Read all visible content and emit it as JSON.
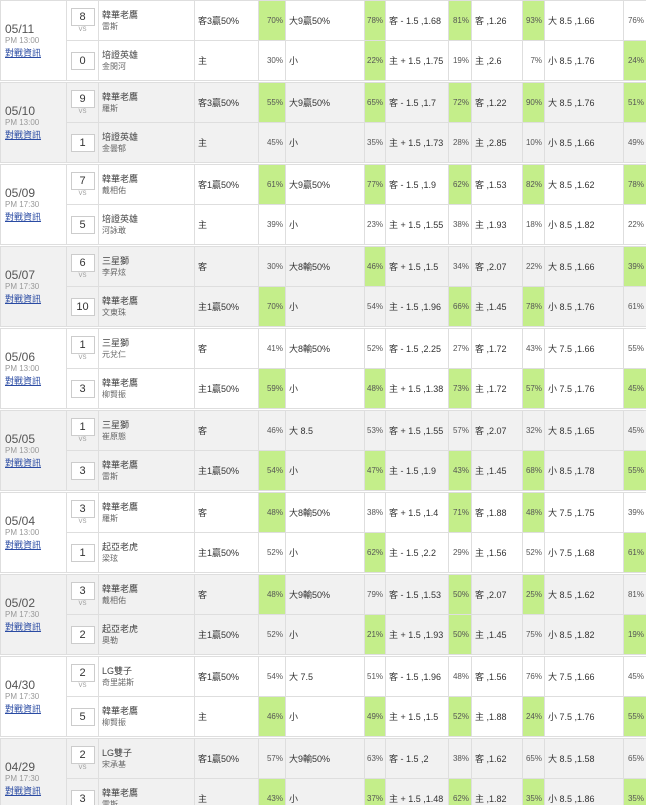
{
  "games": [
    {
      "date": "05/11",
      "time": "PM 13:00",
      "link": "對戰資訊",
      "away": {
        "score": "8",
        "team": "韓華老鷹",
        "pitcher": "雷斯"
      },
      "home": {
        "score": "0",
        "team": "培證英雄",
        "pitcher": "金閔河"
      },
      "away_line": {
        "h": "客3贏50%",
        "hp": "70%",
        "ou": "大9贏50%",
        "oup": "78%",
        "rl": "客 - 1.5 ,1.68",
        "rlp": "81%",
        "ml": "客 ,1.26",
        "mlp": "93%",
        "t": "大 8.5 ,1.66",
        "tp": "76%"
      },
      "home_line": {
        "h": "主",
        "hp": "30%",
        "ou": "小",
        "oup": "22%",
        "rl": "主 + 1.5 ,1.75",
        "rlp": "19%",
        "ml": "主 ,2.6",
        "mlp": "7%",
        "t": "小 8.5 ,1.76",
        "tp": "24%"
      },
      "hi_away": [
        "hp",
        "oup",
        "rlp",
        "mlp"
      ],
      "hi_home": [
        "oup",
        "tp"
      ]
    },
    {
      "date": "05/10",
      "time": "PM 13:00",
      "link": "對戰資訊",
      "away": {
        "score": "9",
        "team": "韓華老鷹",
        "pitcher": "羅斯"
      },
      "home": {
        "score": "1",
        "team": "培證英雄",
        "pitcher": "金曇郁"
      },
      "away_line": {
        "h": "客3贏50%",
        "hp": "55%",
        "ou": "大9贏50%",
        "oup": "65%",
        "rl": "客 - 1.5 ,1.7",
        "rlp": "72%",
        "ml": "客 ,1.22",
        "mlp": "90%",
        "t": "大 8.5 ,1.76",
        "tp": "51%"
      },
      "home_line": {
        "h": "主",
        "hp": "45%",
        "ou": "小",
        "oup": "35%",
        "rl": "主 + 1.5 ,1.73",
        "rlp": "28%",
        "ml": "主 ,2.85",
        "mlp": "10%",
        "t": "小 8.5 ,1.66",
        "tp": "49%"
      },
      "hi_away": [
        "hp",
        "oup",
        "rlp",
        "mlp",
        "tp"
      ],
      "hi_home": []
    },
    {
      "date": "05/09",
      "time": "PM 17:30",
      "link": "對戰資訊",
      "away": {
        "score": "7",
        "team": "韓華老鷹",
        "pitcher": "戴相佑"
      },
      "home": {
        "score": "5",
        "team": "培證英雄",
        "pitcher": "河詠敢"
      },
      "away_line": {
        "h": "客1贏50%",
        "hp": "61%",
        "ou": "大9贏50%",
        "oup": "77%",
        "rl": "客 - 1.5 ,1.9",
        "rlp": "62%",
        "ml": "客 ,1.53",
        "mlp": "82%",
        "t": "大 8.5 ,1.62",
        "tp": "78%"
      },
      "home_line": {
        "h": "主",
        "hp": "39%",
        "ou": "小",
        "oup": "23%",
        "rl": "主 + 1.5 ,1.55",
        "rlp": "38%",
        "ml": "主 ,1.93",
        "mlp": "18%",
        "t": "小 8.5 ,1.82",
        "tp": "22%"
      },
      "hi_away": [
        "hp",
        "oup",
        "rlp",
        "mlp",
        "tp"
      ],
      "hi_home": []
    },
    {
      "date": "05/07",
      "time": "PM 17:30",
      "link": "對戰資訊",
      "away": {
        "score": "6",
        "team": "三星獅",
        "pitcher": "李昇炫"
      },
      "home": {
        "score": "10",
        "team": "韓華老鷹",
        "pitcher": "文東珠"
      },
      "away_line": {
        "h": "客",
        "hp": "30%",
        "ou": "大8輸50%",
        "oup": "46%",
        "rl": "客 + 1.5 ,1.5",
        "rlp": "34%",
        "ml": "客 ,2.07",
        "mlp": "22%",
        "t": "大 8.5 ,1.66",
        "tp": "39%"
      },
      "home_line": {
        "h": "主1贏50%",
        "hp": "70%",
        "ou": "小",
        "oup": "54%",
        "rl": "主 - 1.5 ,1.96",
        "rlp": "66%",
        "ml": "主 ,1.45",
        "mlp": "78%",
        "t": "小 8.5 ,1.76",
        "tp": "61%"
      },
      "hi_away": [
        "oup",
        "tp"
      ],
      "hi_home": [
        "hp",
        "rlp",
        "mlp"
      ]
    },
    {
      "date": "05/06",
      "time": "PM 13:00",
      "link": "對戰資訊",
      "away": {
        "score": "1",
        "team": "三星獅",
        "pitcher": "元兌仁"
      },
      "home": {
        "score": "3",
        "team": "韓華老鷹",
        "pitcher": "柳賢振"
      },
      "away_line": {
        "h": "客",
        "hp": "41%",
        "ou": "大8輸50%",
        "oup": "52%",
        "rl": "客 - 1.5 ,2.25",
        "rlp": "27%",
        "ml": "客 ,1.72",
        "mlp": "43%",
        "t": "大 7.5 ,1.66",
        "tp": "55%"
      },
      "home_line": {
        "h": "主1贏50%",
        "hp": "59%",
        "ou": "小",
        "oup": "48%",
        "rl": "主 + 1.5 ,1.38",
        "rlp": "73%",
        "ml": "主 ,1.72",
        "mlp": "57%",
        "t": "小 7.5 ,1.76",
        "tp": "45%"
      },
      "hi_away": [],
      "hi_home": [
        "hp",
        "oup",
        "rlp",
        "mlp",
        "tp"
      ]
    },
    {
      "date": "05/05",
      "time": "PM 13:00",
      "link": "對戰資訊",
      "away": {
        "score": "1",
        "team": "三星獅",
        "pitcher": "崔原態"
      },
      "home": {
        "score": "3",
        "team": "韓華老鷹",
        "pitcher": "雷斯"
      },
      "away_line": {
        "h": "客",
        "hp": "46%",
        "ou": "大 8.5",
        "oup": "53%",
        "rl": "客 + 1.5 ,1.55",
        "rlp": "57%",
        "ml": "客 ,2.07",
        "mlp": "32%",
        "t": "大 8.5 ,1.65",
        "tp": "45%"
      },
      "home_line": {
        "h": "主1贏50%",
        "hp": "54%",
        "ou": "小",
        "oup": "47%",
        "rl": "主 - 1.5 ,1.9",
        "rlp": "43%",
        "ml": "主 ,1.45",
        "mlp": "68%",
        "t": "小 8.5 ,1.78",
        "tp": "55%"
      },
      "hi_away": [],
      "hi_home": [
        "hp",
        "oup",
        "rlp",
        "mlp",
        "tp"
      ]
    },
    {
      "date": "05/04",
      "time": "PM 13:00",
      "link": "對戰資訊",
      "away": {
        "score": "3",
        "team": "韓華老鷹",
        "pitcher": "羅斯"
      },
      "home": {
        "score": "1",
        "team": "起亞老虎",
        "pitcher": "梁玹"
      },
      "away_line": {
        "h": "客",
        "hp": "48%",
        "ou": "大8輸50%",
        "oup": "38%",
        "rl": "客 + 1.5 ,1.4",
        "rlp": "71%",
        "ml": "客 ,1.88",
        "mlp": "48%",
        "t": "大 7.5 ,1.75",
        "tp": "39%"
      },
      "home_line": {
        "h": "主1贏50%",
        "hp": "52%",
        "ou": "小",
        "oup": "62%",
        "rl": "主 - 1.5 ,2.2",
        "rlp": "29%",
        "ml": "主 ,1.56",
        "mlp": "52%",
        "t": "小 7.5 ,1.68",
        "tp": "61%"
      },
      "hi_away": [
        "hp",
        "rlp",
        "mlp"
      ],
      "hi_home": [
        "oup",
        "tp"
      ]
    },
    {
      "date": "05/02",
      "time": "PM 17:30",
      "link": "對戰資訊",
      "away": {
        "score": "3",
        "team": "韓華老鷹",
        "pitcher": "戴相佑"
      },
      "home": {
        "score": "2",
        "team": "起亞老虎",
        "pitcher": "奧勒"
      },
      "away_line": {
        "h": "客",
        "hp": "48%",
        "ou": "大9輸50%",
        "oup": "79%",
        "rl": "客 - 1.5 ,1.53",
        "rlp": "50%",
        "ml": "客 ,2.07",
        "mlp": "25%",
        "t": "大 8.5 ,1.62",
        "tp": "81%"
      },
      "home_line": {
        "h": "主1贏50%",
        "hp": "52%",
        "ou": "小",
        "oup": "21%",
        "rl": "主 + 1.5 ,1.93",
        "rlp": "50%",
        "ml": "主 ,1.45",
        "mlp": "75%",
        "t": "小 8.5 ,1.82",
        "tp": "19%"
      },
      "hi_away": [
        "hp",
        "rlp",
        "mlp"
      ],
      "hi_home": [
        "oup",
        "rlp",
        "tp"
      ]
    },
    {
      "date": "04/30",
      "time": "PM 17:30",
      "link": "對戰資訊",
      "away": {
        "score": "2",
        "team": "LG雙子",
        "pitcher": "奇里諾斯"
      },
      "home": {
        "score": "5",
        "team": "韓華老鷹",
        "pitcher": "柳賢振"
      },
      "away_line": {
        "h": "客1贏50%",
        "hp": "54%",
        "ou": "大 7.5",
        "oup": "51%",
        "rl": "客 - 1.5 ,1.96",
        "rlp": "48%",
        "ml": "客 ,1.56",
        "mlp": "76%",
        "t": "大 7.5 ,1.66",
        "tp": "45%"
      },
      "home_line": {
        "h": "主",
        "hp": "46%",
        "ou": "小",
        "oup": "49%",
        "rl": "主 + 1.5 ,1.5",
        "rlp": "52%",
        "ml": "主 ,1.88",
        "mlp": "24%",
        "t": "小 7.5 ,1.76",
        "tp": "55%"
      },
      "hi_away": [],
      "hi_home": [
        "hp",
        "oup",
        "rlp",
        "mlp",
        "tp"
      ]
    },
    {
      "date": "04/29",
      "time": "PM 17:30",
      "link": "對戰資訊",
      "away": {
        "score": "2",
        "team": "LG雙子",
        "pitcher": "宋承基"
      },
      "home": {
        "score": "3",
        "team": "韓華老鷹",
        "pitcher": "雷斯"
      },
      "away_line": {
        "h": "客1贏50%",
        "hp": "57%",
        "ou": "大9輸50%",
        "oup": "63%",
        "rl": "客 - 1.5 ,2",
        "rlp": "38%",
        "ml": "客 ,1.62",
        "mlp": "65%",
        "t": "大 8.5 ,1.58",
        "tp": "65%"
      },
      "home_line": {
        "h": "主",
        "hp": "43%",
        "ou": "小",
        "oup": "37%",
        "rl": "主 + 1.5 ,1.48",
        "rlp": "62%",
        "ml": "主 ,1.82",
        "mlp": "35%",
        "t": "小 8.5 ,1.86",
        "tp": "35%"
      },
      "hi_away": [],
      "hi_home": [
        "hp",
        "oup",
        "rlp",
        "mlp",
        "tp"
      ]
    }
  ],
  "vs_label": "VS",
  "colors": {
    "highlight": "#c4ee8a",
    "link": "#2a4ba3",
    "row_even": "#f1f1f1"
  }
}
